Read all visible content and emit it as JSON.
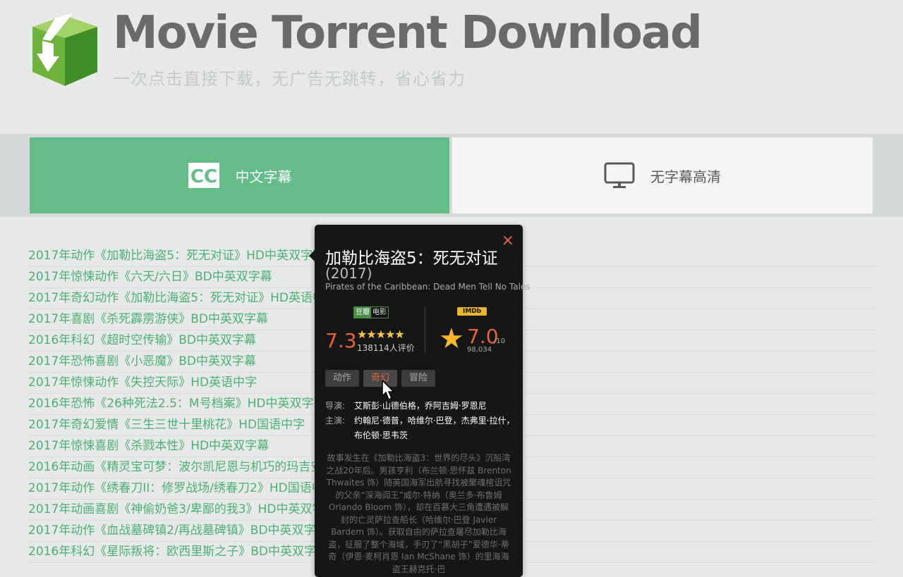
{
  "header": {
    "title": "Movie Torrent Download",
    "subtitle": "一次点击直接下载，无广告无跳转，省心省力",
    "logo_icon": "download-box-icon"
  },
  "tabs": [
    {
      "label": "中文字幕",
      "icon": "cc-icon",
      "active": true
    },
    {
      "label": "无字幕高清",
      "icon": "monitor-icon",
      "active": false
    }
  ],
  "movies": [
    "2017年动作《加勒比海盗5：死无对证》HD中英双字幕",
    "2017年惊悚动作《六天/六日》BD中英双字幕",
    "2017年奇幻动作《加勒比海盗5：死无对证》HD英语中字",
    "2017年喜剧《杀死霹雳游侠》BD中英双字幕",
    "2016年科幻《超时空传输》BD中英双字幕",
    "2017年恐怖喜剧《小恶魔》BD中英双字幕",
    "2017年惊悚动作《失控天际》HD英语中字",
    "2016年恐怖《26种死法2.5：M号档案》HD中英双字幕",
    "2017年奇幻爱情《三生三世十里桃花》HD国语中字",
    "2017年惊悚喜剧《杀戮本性》HD中英双字幕",
    "2016年动画《精灵宝可梦：波尔凯尼恩与机巧的玛吉安",
    "2017年动作《绣春刀II：修罗战场/绣春刀2》HD国语中字",
    "2017年动画喜剧《神偷奶爸3/卑鄙的我3》HD中英双字幕",
    "2017年动作《血战墓碑镇2/再战墓碑镇》BD中英双字幕",
    "2016年科幻《星际叛将：欧西里斯之子》BD中英双字幕"
  ],
  "popup": {
    "close": "×",
    "title": "加勒比海盗5：死无对证",
    "year": "(2017)",
    "original_title": "Pirates of the Caribbean: Dead Men Tell No Tales",
    "douban": {
      "badge_a": "豆瓣",
      "badge_b": "电影",
      "score": "7.3",
      "stars": "★★★★★",
      "rating_fraction": 0.73,
      "count": "138114人评价"
    },
    "imdb": {
      "badge": "IMDb",
      "score": "7.0",
      "of": "/10",
      "count": "98,034"
    },
    "genres": [
      {
        "label": "动作",
        "active": false
      },
      {
        "label": "奇幻",
        "active": true
      },
      {
        "label": "冒险",
        "active": false
      }
    ],
    "director_label": "导演:",
    "director": "艾斯彭·山德伯格，乔阿吉姆·罗恩尼",
    "cast_label": "主演:",
    "cast": "约翰尼·德普，哈维尔·巴登，杰弗里·拉什，布伦顿·思韦茨",
    "synopsis": "故事发生在《加勒比海盗3：世界的尽头》沉船湾之战20年后。男孩亨利（布兰顿·思怀兹 Brenton Thwaites 饰）随英国海军出航寻找被聚魂棺诅咒的父亲“深海阎王”威尔·特纳（奥兰多·布鲁姆 Orlando Bloom 饰），却在百慕大三角遭遇被解封的亡灵萨拉查船长（哈维尔·巴登 Javier Bardem 饰）。获取自由的萨拉查屠尽加勒比海盗，征服了整个海域，手刃了“黑胡子”爱德华·蒂奇（伊恩·麦柯肖恩 Ian McShane 饰）的里海海盗王赫克托·巴"
  },
  "colors": {
    "accent_green": "#64bd88",
    "link_green": "#4cb073",
    "score_orange": "#e8633a",
    "popup_bg": "#161616"
  }
}
